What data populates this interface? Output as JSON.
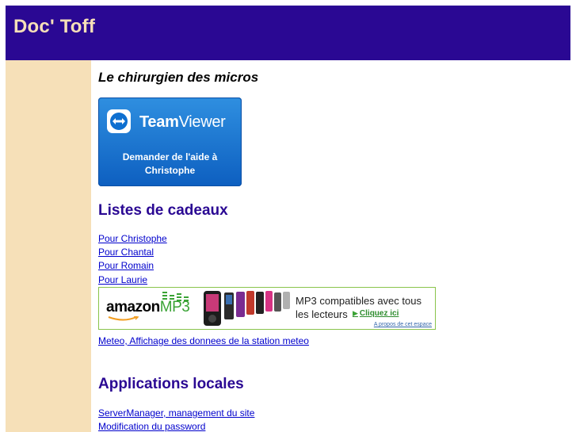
{
  "header": {
    "site_title": "Doc' Toff"
  },
  "main": {
    "tagline": "Le chirurgien des micros",
    "teamviewer": {
      "brand_bold": "Team",
      "brand_light": "Viewer",
      "caption_line1": "Demander de l'aide à",
      "caption_line2": "Christophe"
    },
    "gifts": {
      "heading": "Listes de cadeaux",
      "links": [
        "Pour Christophe",
        "Pour Chantal",
        "Pour Romain",
        "Pour Laurie"
      ]
    },
    "amazon_ad": {
      "logo_text": "amazon",
      "logo_mp3": "MP3",
      "line1": "MP3 compatibles avec tous",
      "line2": "les lecteurs",
      "cta": "Cliquez ici",
      "about": "A propos de cet espace"
    },
    "meteo_link": "Meteo, Affichage des donnees de la station meteo",
    "local_apps": {
      "heading": "Applications locales",
      "links": [
        "ServerManager, management du site",
        "Modification du password"
      ]
    }
  },
  "colors": {
    "header_bg": "#2a0893",
    "sidebar_bg": "#f6e0b8",
    "heading": "#2a0893",
    "link": "#0000cc"
  }
}
